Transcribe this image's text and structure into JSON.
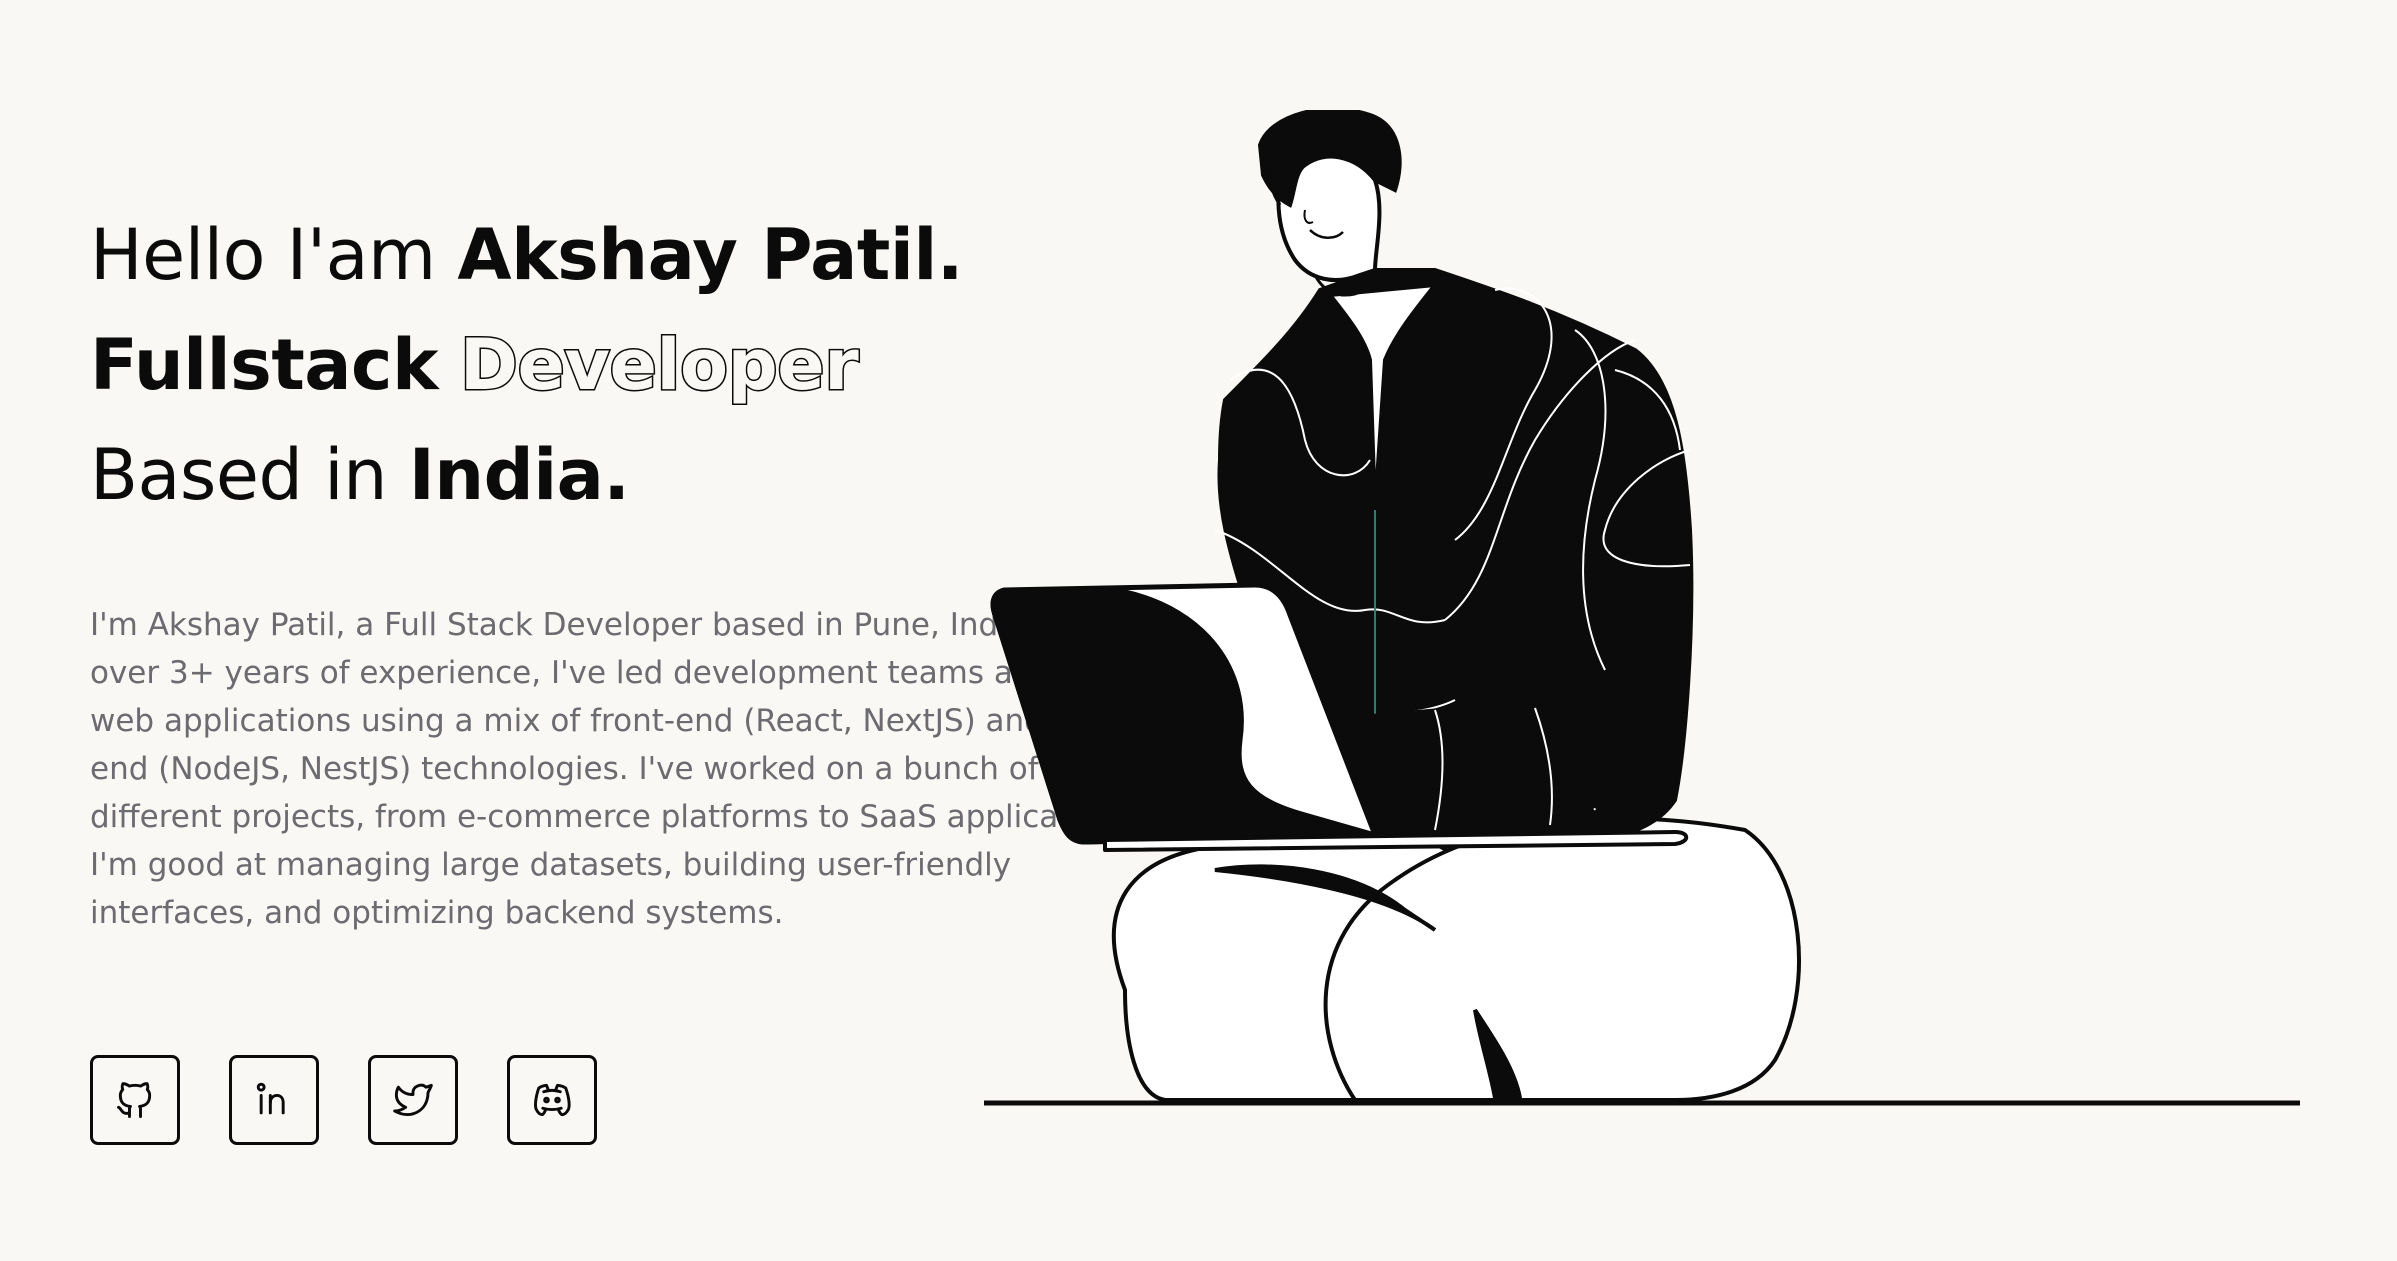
{
  "hero": {
    "line1_prefix": "Hello I'am ",
    "line1_name": "Akshay Patil.",
    "line2_bold": "Fullstack",
    "line2_outline": "Developer",
    "line3_prefix": "Based in ",
    "line3_place": "India."
  },
  "bio": "I'm Akshay Patil, a Full Stack Developer based in Pune, India. With over 3+ years of experience, I've led development teams and built web applications using a mix of front-end (React, NextJS) and back-end (NodeJS, NestJS) technologies. I've worked on a bunch of different projects, from e-commerce platforms to SaaS applications. I'm good at managing large datasets, building user-friendly interfaces, and optimizing backend systems.",
  "socials": [
    {
      "icon": "github-icon"
    },
    {
      "icon": "linkedin-icon"
    },
    {
      "icon": "twitter-icon"
    },
    {
      "icon": "discord-icon"
    }
  ],
  "colors": {
    "background": "#f9f8f5",
    "text": "#0b0b0b",
    "muted": "#6b6b70"
  }
}
